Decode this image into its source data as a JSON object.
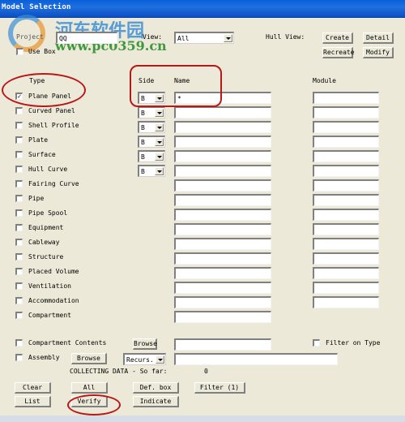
{
  "window": {
    "title": "Model Selection"
  },
  "watermark": {
    "text_cn": "河东软件园",
    "url": "www.pc0359.cn"
  },
  "header": {
    "project_label": "Project",
    "project_value": "QQ",
    "view_label": "View:",
    "view_value": "All",
    "use_box_label": "Use Box",
    "hull_view_label": "Hull View:",
    "buttons": {
      "create": "Create",
      "detail": "Detail",
      "recreate": "Recreate",
      "modify": "Modify"
    }
  },
  "columns": {
    "type": "Type",
    "side": "Side",
    "name": "Name",
    "module": "Module"
  },
  "rows": [
    {
      "type": "Plane Panel",
      "checked": true,
      "side": "B",
      "name": "*",
      "has_side": true,
      "has_module": true
    },
    {
      "type": "Curved Panel",
      "checked": false,
      "side": "B",
      "name": "",
      "has_side": true,
      "has_module": true
    },
    {
      "type": "Shell Profile",
      "checked": false,
      "side": "B",
      "name": "",
      "has_side": true,
      "has_module": true
    },
    {
      "type": "Plate",
      "checked": false,
      "side": "B",
      "name": "",
      "has_side": true,
      "has_module": true
    },
    {
      "type": "Surface",
      "checked": false,
      "side": "B",
      "name": "",
      "has_side": true,
      "has_module": true
    },
    {
      "type": "Hull Curve",
      "checked": false,
      "side": "B",
      "name": "",
      "has_side": true,
      "has_module": true
    },
    {
      "type": "Fairing Curve",
      "checked": false,
      "name": "",
      "has_side": false,
      "has_module": true
    },
    {
      "type": "Pipe",
      "checked": false,
      "name": "",
      "has_side": false,
      "has_module": true
    },
    {
      "type": "Pipe Spool",
      "checked": false,
      "name": "",
      "has_side": false,
      "has_module": true
    },
    {
      "type": "Equipment",
      "checked": false,
      "name": "",
      "has_side": false,
      "has_module": true
    },
    {
      "type": "Cableway",
      "checked": false,
      "name": "",
      "has_side": false,
      "has_module": true
    },
    {
      "type": "Structure",
      "checked": false,
      "name": "",
      "has_side": false,
      "has_module": true
    },
    {
      "type": "Placed Volume",
      "checked": false,
      "name": "",
      "has_side": false,
      "has_module": true
    },
    {
      "type": "Ventilation",
      "checked": false,
      "name": "",
      "has_side": false,
      "has_module": true
    },
    {
      "type": "Accommodation",
      "checked": false,
      "name": "",
      "has_side": false,
      "has_module": true
    },
    {
      "type": "Compartment",
      "checked": false,
      "name": "",
      "has_side": false,
      "has_module": false
    }
  ],
  "extras": {
    "compartment_contents_label": "Compartment Contents",
    "compartment_contents_checked": false,
    "browse_label": "Browse",
    "filter_on_type_label": "Filter on Type",
    "filter_on_type_checked": false,
    "assembly_label": "Assembly",
    "assembly_checked": false,
    "recurs_value": "Recurs.",
    "collecting_label": "COLLECTING DATA - So far:",
    "collecting_count": "0"
  },
  "actions": {
    "clear": "Clear",
    "all": "All",
    "def_box": "Def. box",
    "filter": "Filter (1)",
    "list": "List",
    "verify": "Verify",
    "indicate": "Indicate"
  }
}
